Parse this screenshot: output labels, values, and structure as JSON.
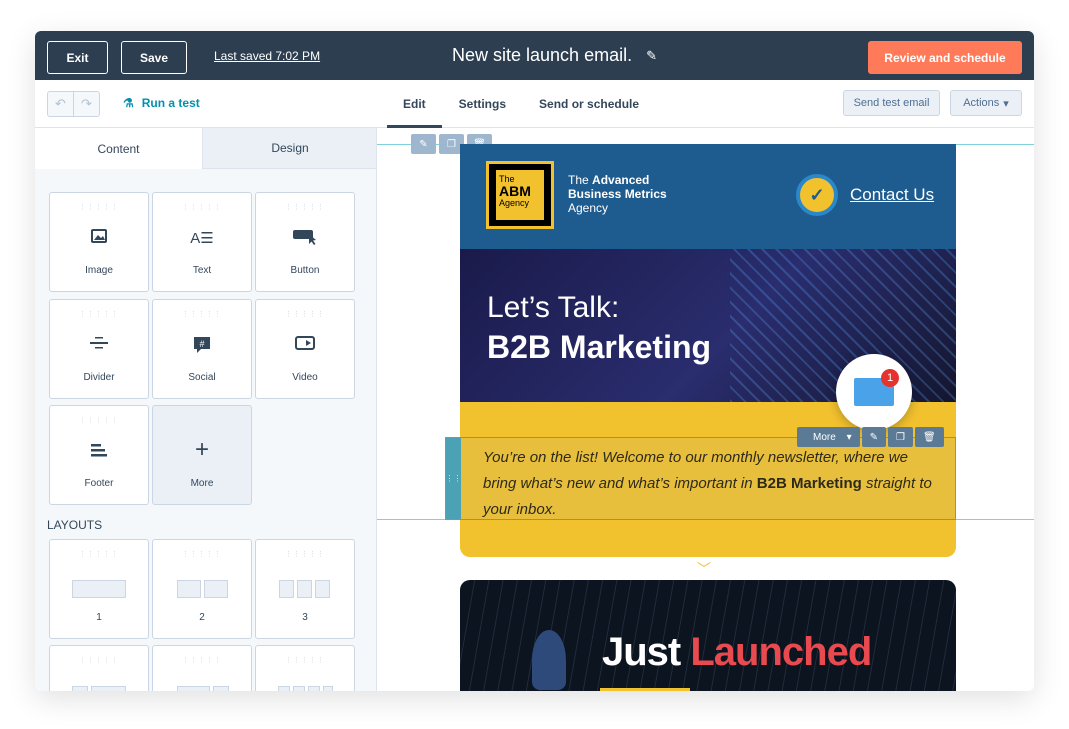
{
  "topbar": {
    "exit_label": "Exit",
    "save_label": "Save",
    "last_saved": "Last saved 7:02 PM",
    "title": "New site launch email.",
    "review_label": "Review and schedule"
  },
  "subbar": {
    "run_test": "Run a test",
    "tabs": [
      "Edit",
      "Settings",
      "Send or schedule"
    ],
    "send_test": "Send test email",
    "actions": "Actions"
  },
  "left_panel": {
    "tabs": [
      "Content",
      "Design"
    ],
    "modules": [
      {
        "label": "Image",
        "icon": "image-icon"
      },
      {
        "label": "Text",
        "icon": "text-icon"
      },
      {
        "label": "Button",
        "icon": "button-icon"
      },
      {
        "label": "Divider",
        "icon": "divider-icon"
      },
      {
        "label": "Social",
        "icon": "social-icon"
      },
      {
        "label": "Video",
        "icon": "video-icon"
      },
      {
        "label": "Footer",
        "icon": "footer-icon"
      },
      {
        "label": "More",
        "icon": "plus-icon"
      }
    ],
    "layouts_label": "LAYOUTS",
    "layouts": [
      "1",
      "2",
      "3"
    ]
  },
  "email": {
    "agency": {
      "the": "The",
      "line1": "Advanced",
      "line2": "Business Metrics",
      "line3": "Agency"
    },
    "logo": {
      "the": "The",
      "abm": "ABM",
      "agency": "Agency"
    },
    "contact": "Contact Us",
    "banner_line1": "Let’s Talk:",
    "banner_line2": "B2B Marketing",
    "mail_badge": "1",
    "more_label": "More",
    "body_part1": "You’re on the list! Welcome to our monthly newsletter, where we bring what’s new and what’s important in ",
    "body_bold": "B2B Marketing",
    "body_part2": " straight to your inbox.",
    "launch_word1": "Just",
    "launch_word2": "Launched"
  },
  "colors": {
    "topbar": "#2d3e50",
    "accent_orange": "#ff7a59",
    "link_teal": "#0091ae",
    "email_blue": "#1e5b8f",
    "email_yellow": "#f2c12e",
    "launch_red": "#e84a4f"
  }
}
